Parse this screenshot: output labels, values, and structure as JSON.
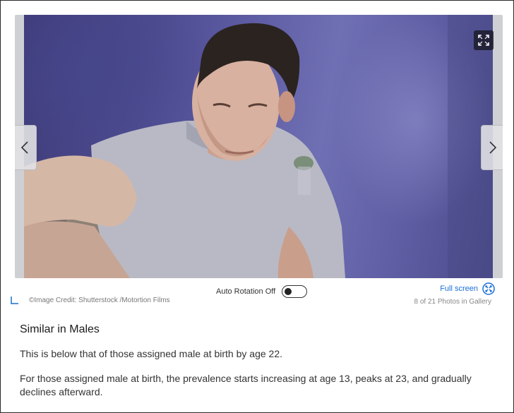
{
  "gallery": {
    "photo_alt": "",
    "fullscreen_icon": "expand-icon",
    "prev_icon": "chevron-left-icon",
    "next_icon": "chevron-right-icon"
  },
  "controls": {
    "auto_rotation_label": "Auto Rotation Off",
    "auto_rotation_on": false,
    "fullscreen_label": "Full screen",
    "credit": "©Image Credit: Shutterstock /Motortion Films",
    "gallery_count": "8 of 21 Photos in Gallery"
  },
  "article": {
    "heading": "Similar in Males",
    "paragraph_1": "This is below that of those assigned male at birth by age 22.",
    "paragraph_2": "For those assigned male at birth, the prevalence starts increasing at age 13, peaks at 23, and gradually declines afterward."
  },
  "colors": {
    "link": "#1a6fd6",
    "photo_tint": "#5f5ea4"
  }
}
